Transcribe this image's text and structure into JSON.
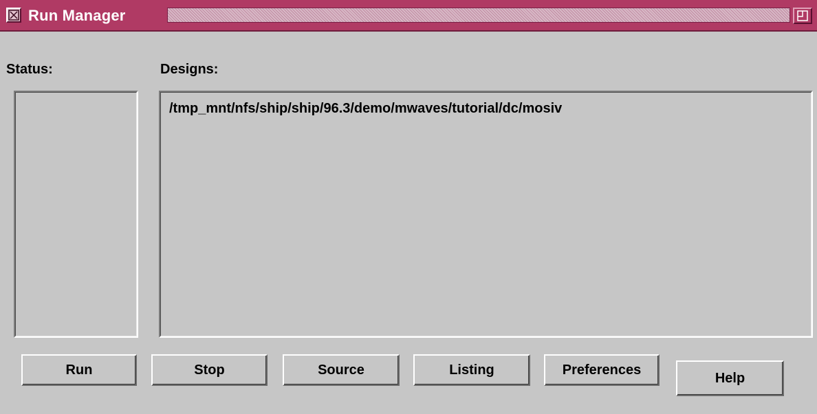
{
  "window": {
    "title": "Run Manager",
    "menu_icon": "window-menu-icon",
    "maximize_icon": "maximize-icon",
    "titlebar_color": "#b03a64"
  },
  "status": {
    "label": "Status:",
    "items": []
  },
  "designs": {
    "label": "Designs:",
    "items": [
      "/tmp_mnt/nfs/ship/ship/96.3/demo/mwaves/tutorial/dc/mosiv"
    ]
  },
  "buttons": {
    "run": "Run",
    "stop": "Stop",
    "source": "Source",
    "listing": "Listing",
    "preferences": "Preferences",
    "help": "Help"
  }
}
